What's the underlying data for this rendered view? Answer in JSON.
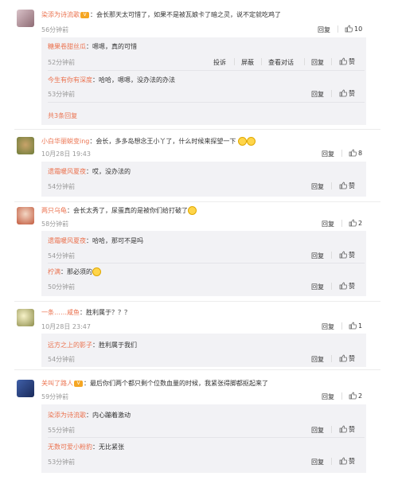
{
  "colors": {
    "username": "#eb7350",
    "reply_bg": "#f2f2f5",
    "time": "#999999"
  },
  "comments": [
    {
      "user": "染添为诗流歌",
      "text": "：会长那天太可惜了，如果不是被瓦娘卡了暗之灵，说不定就吃鸡了",
      "time": "56分钟前",
      "reply_label": "回复",
      "likes": "10",
      "replies": [
        {
          "user": "糖果卷甜丝瓜",
          "text": "：嗯嗯，真的可惜",
          "time": "52分钟前",
          "extra": [
            "投诉",
            "屏蔽",
            "查看对话"
          ],
          "reply_label": "回复",
          "likes": "赞"
        },
        {
          "user": "今生有你有深度",
          "text": "：哈哈，嗯嗯，没办法的办法",
          "time": "53分钟前",
          "reply_label": "回复",
          "likes": "赞"
        }
      ],
      "more": "共3条回复"
    },
    {
      "user": "小白华丽蜕变ing",
      "text": "：会长，多多岛想念王小丫了，什么时候来探望一下",
      "time": "10月28日 19:43",
      "reply_label": "回复",
      "likes": "8",
      "replies": [
        {
          "user": "遗霜暖风夏夜",
          "text": "：哎，没办法的",
          "time": "54分钟前",
          "reply_label": "回复",
          "likes": "赞"
        }
      ]
    },
    {
      "user": "两只乌龟",
      "text": "：会长太秀了，尿蛋真的是被你们给打破了",
      "time": "58分钟前",
      "reply_label": "回复",
      "likes": "2",
      "replies": [
        {
          "user": "遗霜暖风夏夜",
          "text": "：哈哈，那可不是吗",
          "time": "54分钟前",
          "reply_label": "回复",
          "likes": "赞"
        },
        {
          "user": "柠满",
          "text": "：那必须的",
          "time": "50分钟前",
          "reply_label": "回复",
          "likes": "赞"
        }
      ]
    },
    {
      "user": "一条……咸鱼",
      "text": "：胜利属于？？？",
      "time": "10月28日 23:47",
      "reply_label": "回复",
      "likes": "1",
      "replies": [
        {
          "user": "远方之上的影子",
          "text": "：胜利属于我们",
          "time": "54分钟前",
          "reply_label": "回复",
          "likes": "赞"
        }
      ]
    },
    {
      "user": "关叫了路人",
      "text": "：最后你们两个都只剩个位数血量的时候，我紧张得脚都抠起来了",
      "time": "59分钟前",
      "reply_label": "回复",
      "likes": "2",
      "replies": [
        {
          "user": "染添为诗流歌",
          "text": "：内心蹦着激动",
          "time": "55分钟前",
          "reply_label": "回复",
          "likes": "赞"
        },
        {
          "user": "无数可爱小粉豹",
          "text": "：无比紧张",
          "time": "53分钟前",
          "reply_label": "回复",
          "likes": "赞"
        }
      ]
    }
  ]
}
